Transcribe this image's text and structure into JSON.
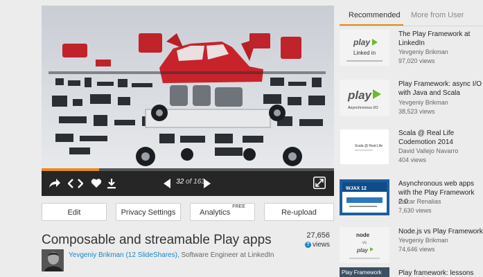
{
  "viewer": {
    "current_page": "32",
    "page_separator": "of",
    "total_pages": "163",
    "progress_fraction": 0.196
  },
  "actions": {
    "edit": "Edit",
    "privacy": "Privacy Settings",
    "analytics": "Analytics",
    "analytics_badge": "FREE",
    "reupload": "Re-upload"
  },
  "presentation": {
    "title": "Composable and streamable Play apps",
    "views_count": "27,656",
    "views_label": "views",
    "author_link": "Yevgeniy Brikman (12 SlideShares)",
    "author_role": ", Software Engineer at LinkedIn"
  },
  "sidebar": {
    "tabs": [
      "Recommended",
      "More from User"
    ],
    "items": [
      {
        "title": "The Play Framework at LinkedIn",
        "author": "Yevgeniy Brikman",
        "views": "97,020 views",
        "thumb_text": "play",
        "thumb_sub": "Linked in"
      },
      {
        "title": "Play Framework: async I/O with Java and Scala",
        "author": "Yevgeniy Brikman",
        "views": "38,523 views",
        "thumb_text": "play",
        "thumb_sub": "Asynchronous I/O"
      },
      {
        "title": "Scala @ Real Life Codemotion 2014",
        "author": "David Vallejo Navarro",
        "views": "404 views",
        "thumb_text": "Scala @ Real Life"
      },
      {
        "title": "Asynchronous web apps with the Play Framework 2.0",
        "author": "Oscar Renalias",
        "views": "7,630 views",
        "thumb_text": "WJAX 12"
      },
      {
        "title": "Node.js vs Play Framework",
        "author": "Yevgeniy Brikman",
        "views": "74,646 views",
        "thumb_text": "node",
        "thumb_sub": "vs",
        "thumb_text2": "play"
      },
      {
        "title": "Play framework: lessons",
        "thumb_text": "Play Framework"
      }
    ]
  },
  "icons": {
    "share": "share-icon",
    "embed": "embed-icon",
    "like": "heart-icon",
    "download": "download-icon",
    "prev": "prev-arrow-icon",
    "next": "next-arrow-icon",
    "fullscreen": "fullscreen-icon"
  },
  "colors": {
    "accent": "#e58a1e",
    "link": "#1a84c7",
    "play_green": "#6cba2f"
  }
}
